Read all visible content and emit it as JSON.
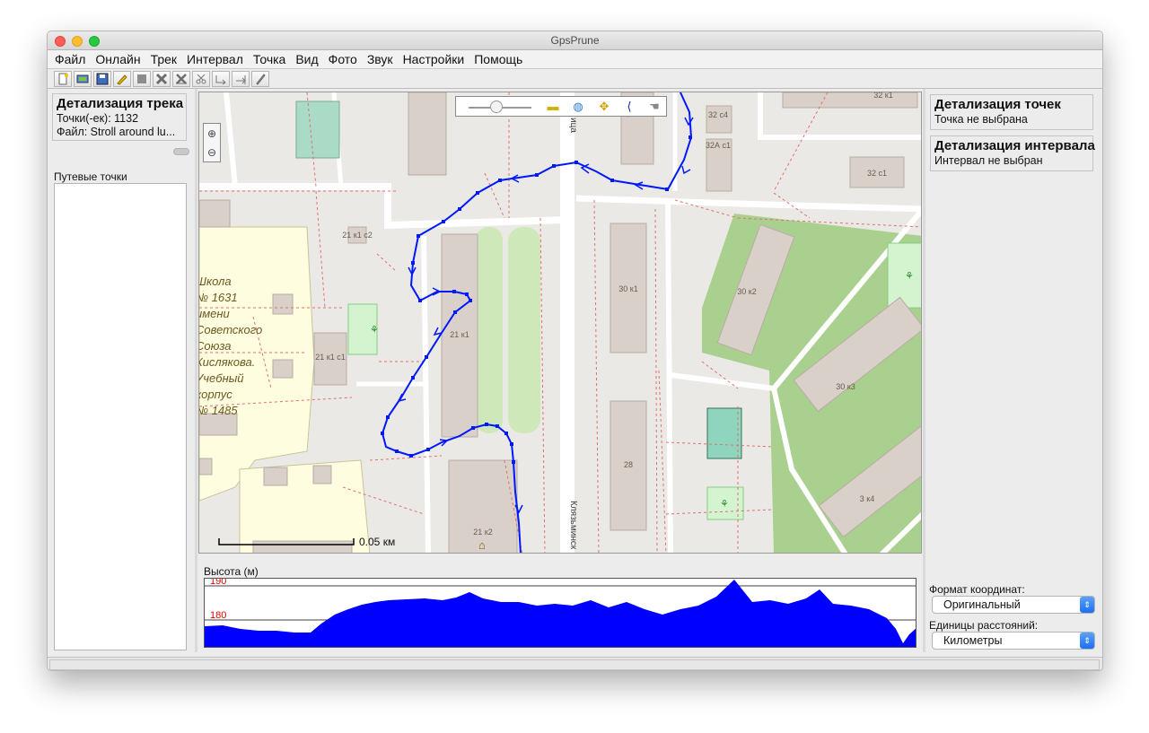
{
  "window": {
    "title": "GpsPrune"
  },
  "menu": [
    "Файл",
    "Онлайн",
    "Трек",
    "Интервал",
    "Точка",
    "Вид",
    "Фото",
    "Звук",
    "Настройки",
    "Помощь"
  ],
  "toolbar": {
    "icons": [
      "new-file-icon",
      "open-file-icon",
      "save-icon",
      "edit-icon",
      "stop-icon",
      "delete-icon",
      "delete-range-icon",
      "cut-icon",
      "connect-icon",
      "append-icon",
      "pen-icon"
    ]
  },
  "track_details": {
    "title": "Детализация трека",
    "points": "Точки(-ек): 1132",
    "file": "Файл: Stroll around lu..."
  },
  "waypoints": {
    "label": "Путевые точки"
  },
  "map": {
    "zoom_in": "⊕",
    "zoom_out": "⊖",
    "scale_label": "0.05 км",
    "labels": {
      "b1": "21 к1 с2",
      "b2": "21 к1 с1",
      "b3": "21 к1",
      "b4": "21 к2",
      "b5": "30 к1",
      "b6": "28",
      "b7": "32 с4",
      "b8": "32А с1",
      "b9": "32 с1",
      "b10": "30 к2",
      "b11": "30 к3",
      "b12": "3 к4",
      "b13": "32 к1",
      "street": "Клязьминск",
      "street2": "ица"
    },
    "school_lines": [
      "Школа",
      "№ 1631",
      "имени",
      "Советского",
      "Союза",
      "Кислякова.",
      "Учебный",
      "корпус",
      "№ 1485"
    ]
  },
  "profile": {
    "label": "Высота (м)",
    "tick_high": "190",
    "tick_low": "180"
  },
  "point_details": {
    "title": "Детализация точек",
    "value": "Точка не выбрана"
  },
  "range_details": {
    "title": "Детализация интервала",
    "value": "Интервал не выбран"
  },
  "coord_format": {
    "label": "Формат координат:",
    "value": "Оригинальный"
  },
  "distance_units": {
    "label": "Единицы расстояний:",
    "value": "Километры"
  },
  "colors": {
    "track": "#0018ff",
    "profile_fill": "#0000ff",
    "profile_tick": "#e00000",
    "park": "#b6d89e",
    "building": "#d9d0c9",
    "school": "#fffde0"
  }
}
